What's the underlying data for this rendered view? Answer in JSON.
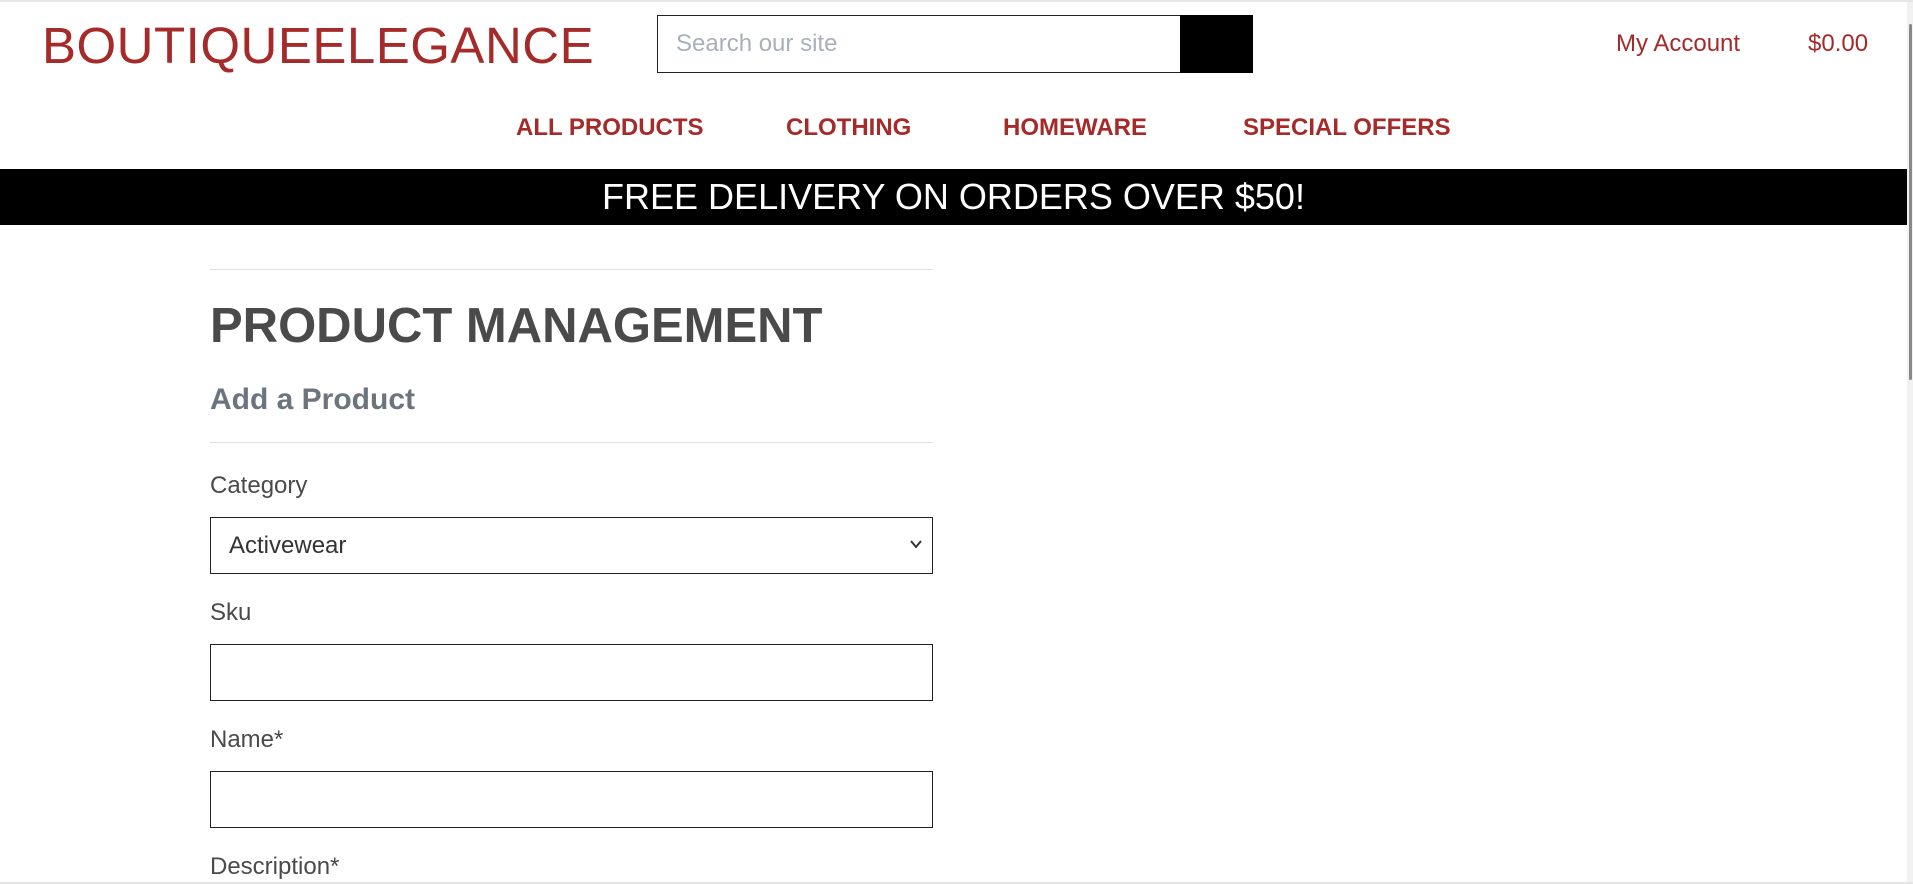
{
  "header": {
    "brand": "BOUTIQUEELEGANCE",
    "search_placeholder": "Search our site",
    "account_label": "My Account",
    "cart_total": "$0.00"
  },
  "nav": {
    "items": [
      {
        "label": "ALL PRODUCTS"
      },
      {
        "label": "CLOTHING"
      },
      {
        "label": "HOMEWARE"
      },
      {
        "label": "SPECIAL OFFERS"
      }
    ]
  },
  "banner": {
    "text": "FREE DELIVERY ON ORDERS OVER $50!"
  },
  "main": {
    "title": "PRODUCT MANAGEMENT",
    "subtitle": "Add a Product",
    "form": {
      "category_label": "Category",
      "category_value": "Activewear",
      "sku_label": "Sku",
      "sku_value": "",
      "name_label": "Name*",
      "name_value": "",
      "description_label": "Description*"
    }
  },
  "colors": {
    "brand": "#a52a2a",
    "banner_bg": "#000000",
    "text": "#4a4a4a"
  }
}
